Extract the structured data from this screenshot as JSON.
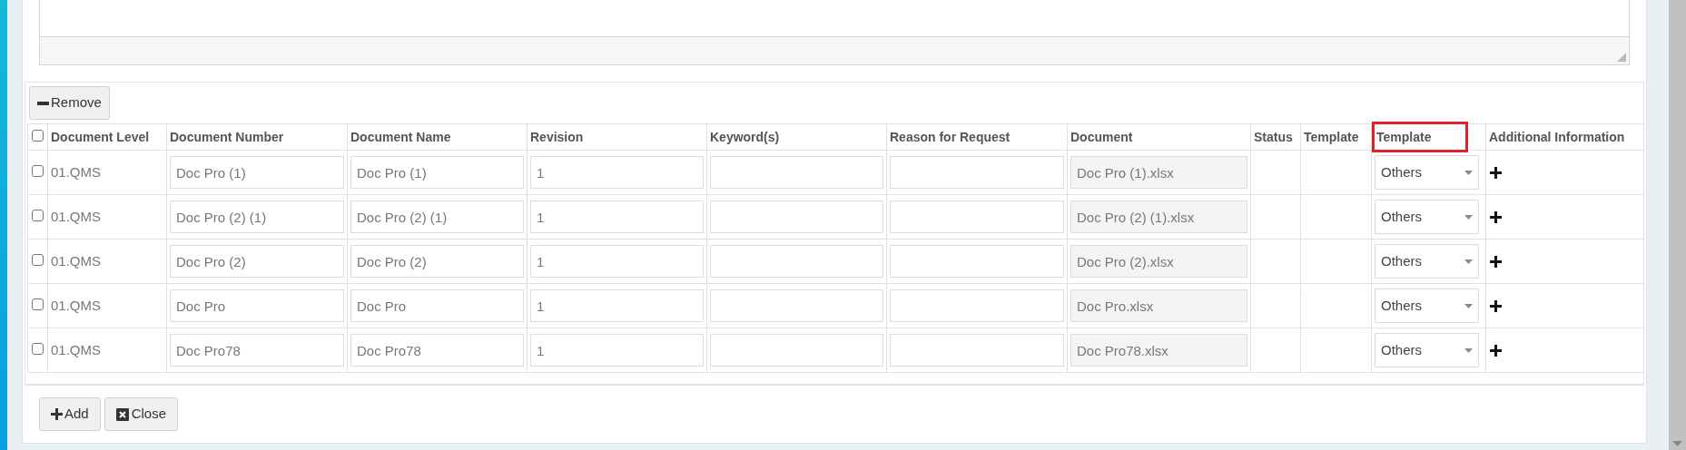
{
  "toolbar": {
    "remove_button": "Remove"
  },
  "table": {
    "select_all": {
      "checked": false
    },
    "columns": [
      {
        "label": "Document Level",
        "highlighted": false
      },
      {
        "label": "Document Number",
        "highlighted": false
      },
      {
        "label": "Document Name",
        "highlighted": false
      },
      {
        "label": "Revision",
        "highlighted": false
      },
      {
        "label": "Keyword(s)",
        "highlighted": false
      },
      {
        "label": "Reason for Request",
        "highlighted": false
      },
      {
        "label": "Document",
        "highlighted": false
      },
      {
        "label": "Status",
        "highlighted": false
      },
      {
        "label": "Template",
        "highlighted": false
      },
      {
        "label": "Template",
        "highlighted": true
      },
      {
        "label": "Additional Information",
        "highlighted": false
      }
    ],
    "rows": [
      {
        "checked": false,
        "document_level": "01.QMS",
        "document_number": "Doc Pro (1)",
        "document_name": "Doc Pro (1)",
        "revision": "1",
        "document": "Doc Pro (1).xlsx",
        "template": "Others"
      },
      {
        "checked": false,
        "document_level": "01.QMS",
        "document_number": "Doc Pro (2) (1)",
        "document_name": "Doc Pro (2) (1)",
        "revision": "1",
        "document": "Doc Pro (2) (1).xlsx",
        "template": "Others"
      },
      {
        "checked": false,
        "document_level": "01.QMS",
        "document_number": "Doc Pro (2)",
        "document_name": "Doc Pro (2)",
        "revision": "1",
        "document": "Doc Pro (2).xlsx",
        "template": "Others"
      },
      {
        "checked": false,
        "document_level": "01.QMS",
        "document_number": "Doc Pro",
        "document_name": "Doc Pro",
        "revision": "1",
        "document": "Doc Pro.xlsx",
        "template": "Others"
      },
      {
        "checked": false,
        "document_level": "01.QMS",
        "document_number": "Doc Pro78",
        "document_name": "Doc Pro78",
        "revision": "1",
        "document": "Doc Pro78.xlsx",
        "template": "Others"
      }
    ]
  },
  "footer": {
    "add_button": "Add",
    "close_button": "Close"
  }
}
